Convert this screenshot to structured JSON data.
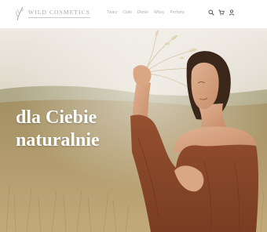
{
  "brand": {
    "name": "WILD COSMETICS",
    "logo_icon": "feather-leaf-icon"
  },
  "nav": {
    "items": [
      {
        "label": "Twarz"
      },
      {
        "label": "Ciało"
      },
      {
        "label": "Dłonie"
      },
      {
        "label": "Włosy"
      },
      {
        "label": "Perfumy"
      }
    ]
  },
  "header_icons": [
    "search-icon",
    "cart-icon",
    "user-icon"
  ],
  "hero": {
    "headline_line1": "dla Ciebie",
    "headline_line2": "naturalnie",
    "image": "woman-in-wheat-field"
  },
  "colors": {
    "background": "#ffffff",
    "nav_text": "#b1b1b1",
    "logo_text": "#a8a8a8",
    "headline": "#ffffff",
    "dress": "#8a4528"
  }
}
